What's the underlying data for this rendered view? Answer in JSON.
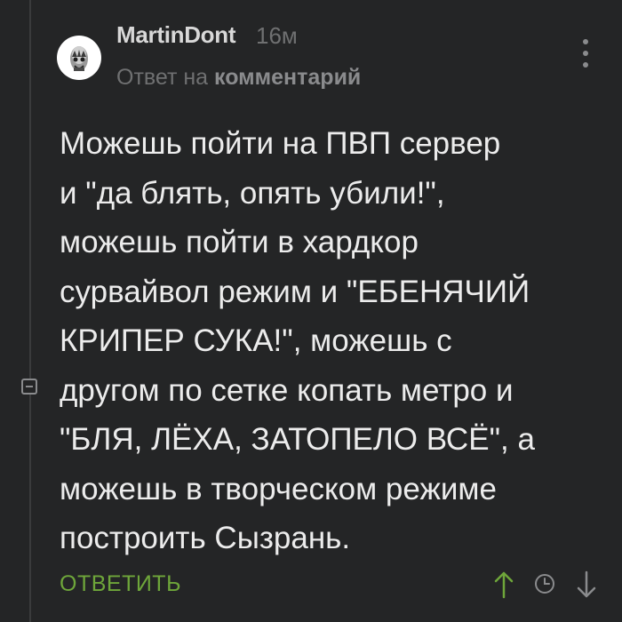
{
  "comment": {
    "author": "MartinDont",
    "time": "16м",
    "reply_prefix": "Ответ на",
    "reply_target": "комментарий",
    "text_lines": [
      "Можешь пойти на ПВП сервер",
      "и \"да блять, опять убили!\",",
      "можешь пойти в хардкор",
      "сурвайвол режим и \"ЕБЕНЯЧИЙ",
      "КРИПЕР СУКА!\", можешь с",
      "другом по сетке копать метро и",
      "\"БЛЯ, ЛЁХА, ЗАТОПЕЛО ВСЁ\", а",
      "можешь в творческом режиме",
      "построить Сызрань."
    ]
  },
  "actions": {
    "reply_label": "ОТВЕТИТЬ"
  },
  "icons": {
    "avatar": "avatar-image",
    "menu": "more-vertical-icon",
    "upvote": "arrow-up-icon",
    "save": "clock-icon",
    "downvote": "arrow-down-icon",
    "collapse": "minus-square-icon"
  },
  "colors": {
    "background": "#242526",
    "accent_green": "#6ea63a",
    "muted_text": "#6f7071"
  }
}
